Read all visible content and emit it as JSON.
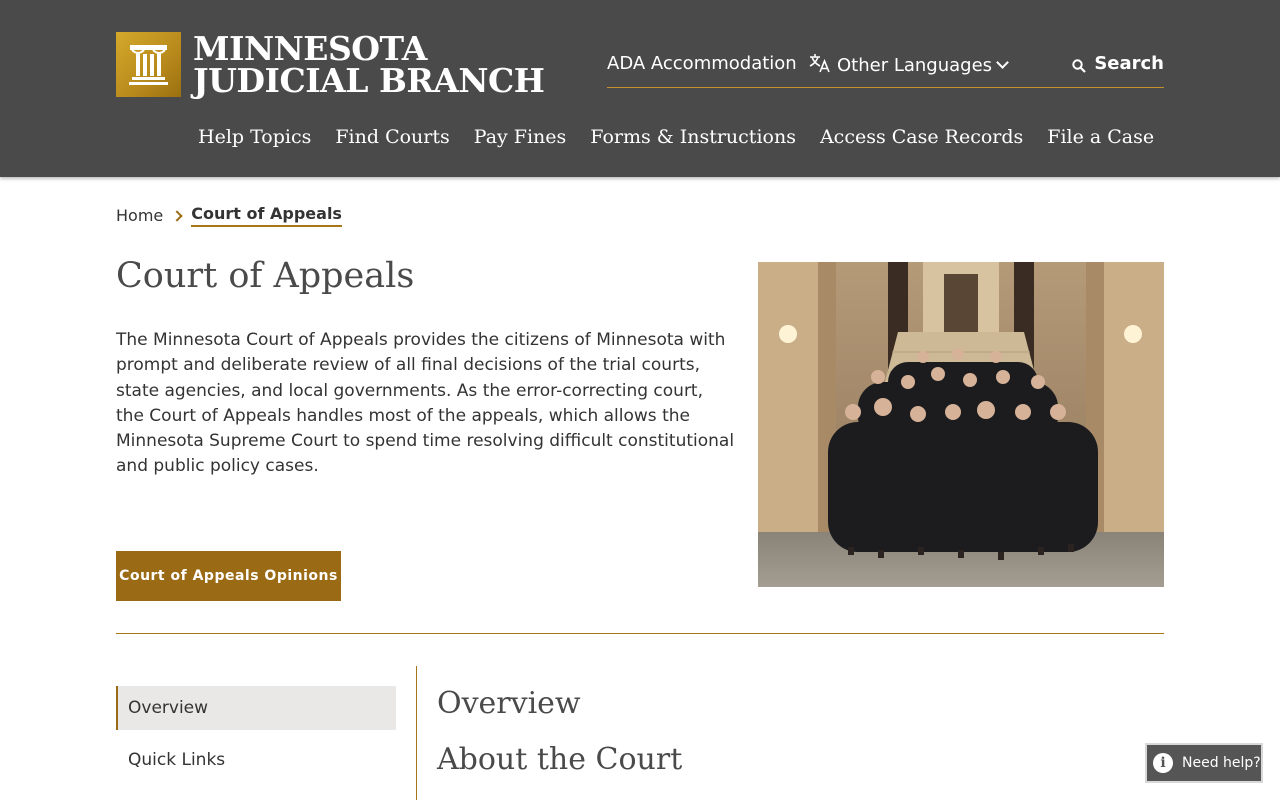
{
  "header": {
    "logo": {
      "line1": "MINNESOTA",
      "line2": "JUDICIAL BRANCH"
    },
    "utility": {
      "ada": "ADA Accommodation",
      "languages": "Other Languages",
      "search": "Search"
    },
    "nav": [
      {
        "label": "Help Topics"
      },
      {
        "label": "Find Courts"
      },
      {
        "label": "Pay Fines"
      },
      {
        "label": "Forms & Instructions"
      },
      {
        "label": "Access Case Records"
      },
      {
        "label": "File a Case"
      }
    ]
  },
  "breadcrumb": {
    "home": "Home",
    "current": "Court of Appeals"
  },
  "hero": {
    "title": "Court of Appeals",
    "intro": "The Minnesota Court of Appeals provides the citizens of Minnesota with prompt and deliberate review of all final decisions of the trial courts, state agencies, and local governments. As the error-correcting court, the Court of Appeals handles most of the appeals, which allows the Minnesota Supreme Court to spend time resolving difficult constitutional and public policy cases.",
    "cta": "Court of Appeals Opinions"
  },
  "side_nav": [
    {
      "label": "Overview",
      "active": true
    },
    {
      "label": "Quick Links",
      "active": false
    }
  ],
  "content": {
    "heading1": "Overview",
    "heading2": "About the Court"
  },
  "help": {
    "label": "Need help?"
  },
  "colors": {
    "header_bg": "#4a4a4a",
    "accent": "#9a6a15",
    "gold_logo": "#c9a02a"
  }
}
